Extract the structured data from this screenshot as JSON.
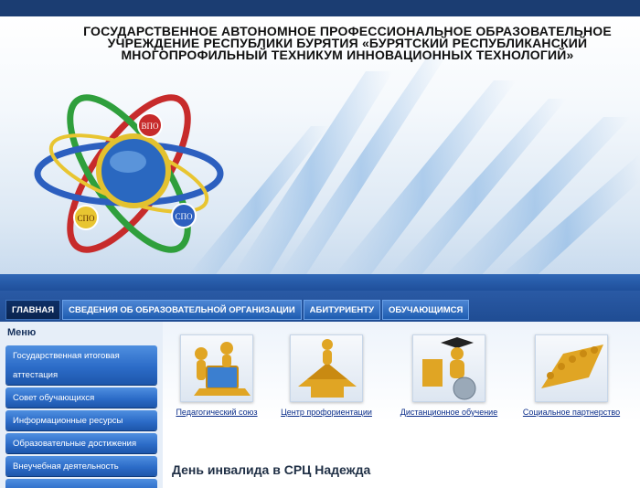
{
  "header": {
    "title": "ГОСУДАРСТВЕННОЕ АВТОНОМНОЕ ПРОФЕССИОНАЛЬНОЕ ОБРАЗОВАТЕЛЬНОЕ УЧРЕЖДЕНИЕ РЕСПУБЛИКИ БУРЯТИЯ «БУРЯТСКИЙ РЕСПУБЛИКАНСКИЙ МНОГОПРОФИЛЬНЫЙ ТЕХНИКУМ ИННОВАЦИОННЫХ ТЕХНОЛОГИЙ»",
    "logo": {
      "badge_top": "ВПО",
      "badge_left": "СПО",
      "badge_right": "СПО"
    }
  },
  "nav": {
    "items": [
      {
        "label": "ГЛАВНАЯ",
        "active": true
      },
      {
        "label": "СВЕДЕНИЯ ОБ ОБРАЗОВАТЕЛЬНОЙ ОРГАНИЗАЦИИ",
        "active": false
      },
      {
        "label": "АБИТУРИЕНТУ",
        "active": false
      },
      {
        "label": "ОБУЧАЮЩИМСЯ",
        "active": false
      }
    ]
  },
  "sidebar": {
    "title": "Меню",
    "items": [
      {
        "label": "Государственная итоговая аттестация"
      },
      {
        "label": "Совет обучающихся"
      },
      {
        "label": "Информационные ресурсы"
      },
      {
        "label": "Образовательные достижения"
      },
      {
        "label": "Внеучебная деятельность"
      }
    ]
  },
  "main": {
    "promos": [
      {
        "label": "Педагогический союз",
        "icon": "figures-laptop-icon"
      },
      {
        "label": "Центр профориентации",
        "icon": "crossroads-arrows-icon"
      },
      {
        "label": "Дистанционное обучение",
        "icon": "graduate-globe-icon"
      },
      {
        "label": "Социальное партнерство",
        "icon": "puzzle-team-icon"
      }
    ],
    "news_title": "День инвалида в СРЦ Надежда"
  },
  "colors": {
    "dark_navy": "#1b3d72",
    "nav_blue": "#1e5cb0",
    "menu_blue": "#2c6cc8",
    "link_blue": "#0b2e8a",
    "gold": "#e0a524"
  }
}
